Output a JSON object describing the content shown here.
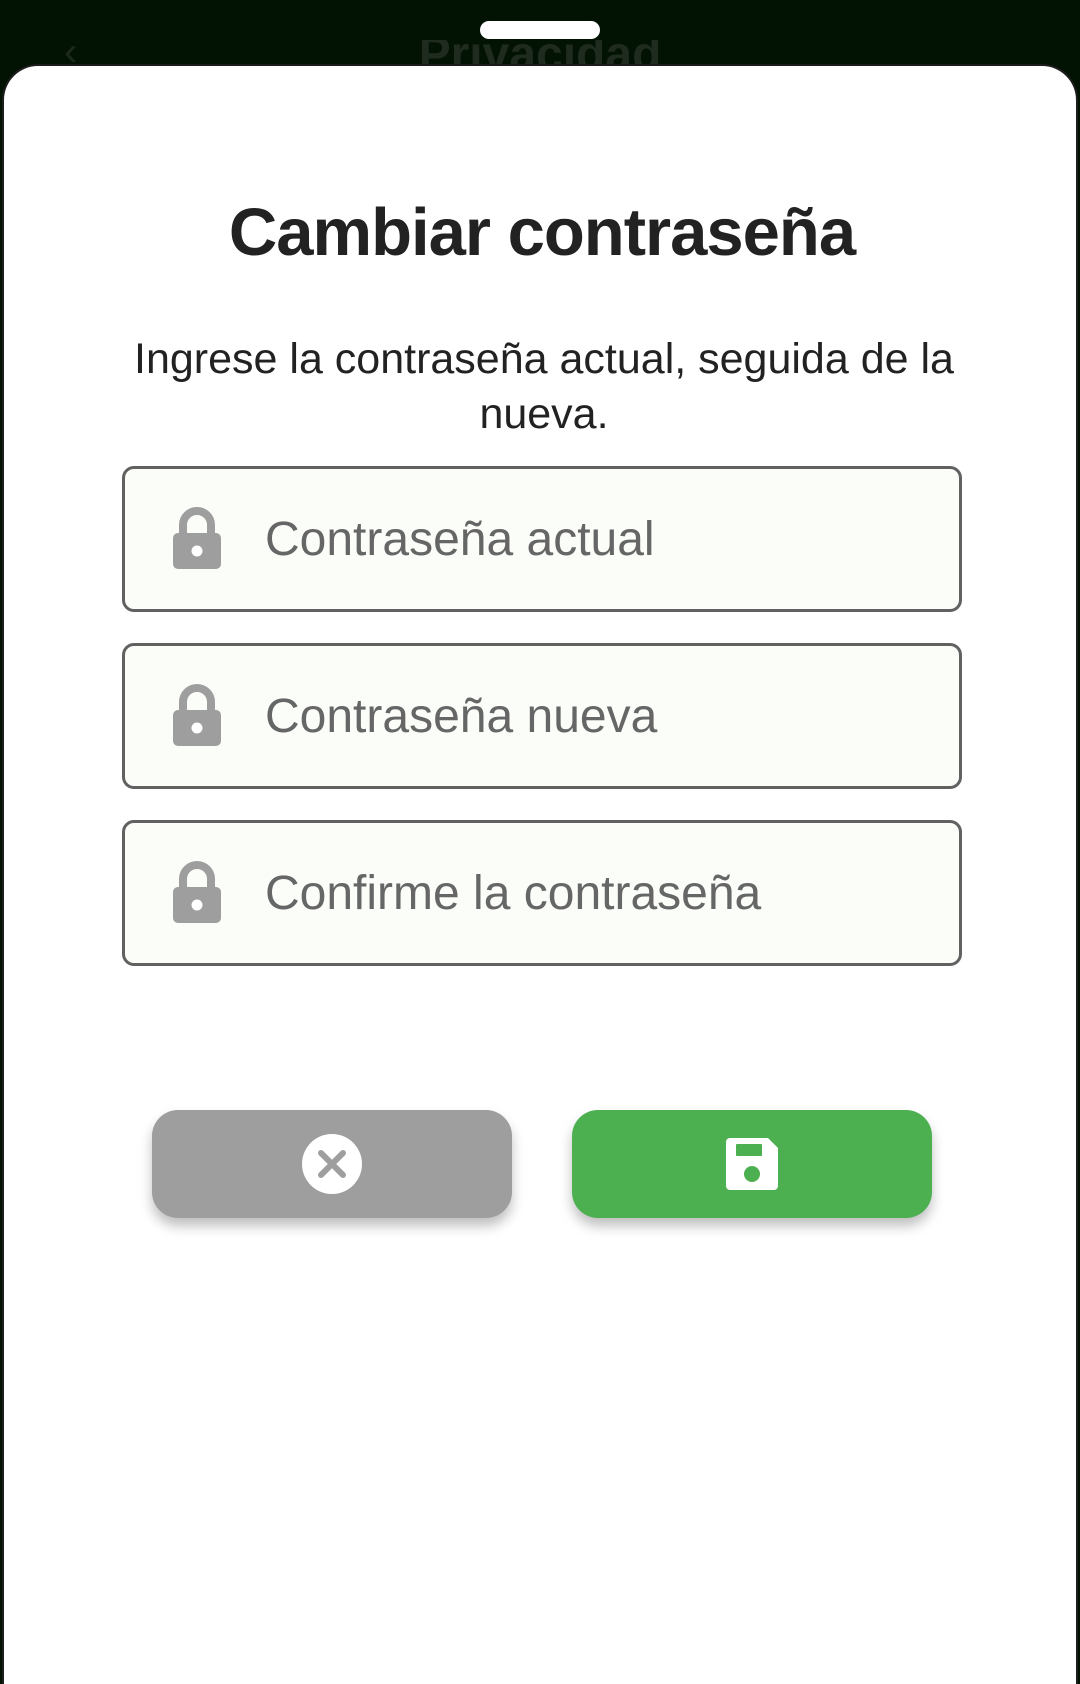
{
  "background_screen": {
    "title": "Privacidad",
    "back_icon": "back-arrow-icon"
  },
  "dialog": {
    "title": "Cambiar contraseña",
    "description": "Ingrese la contraseña actual, seguida de la nueva."
  },
  "fields": [
    {
      "placeholder": "Contraseña actual",
      "value": "",
      "icon": "lock-icon"
    },
    {
      "placeholder": "Contraseña nueva",
      "value": "",
      "icon": "lock-icon"
    },
    {
      "placeholder": "Confirme la contraseña",
      "value": "",
      "icon": "lock-icon"
    }
  ],
  "buttons": {
    "cancel": {
      "icon": "cancel-circle-icon",
      "color": "#9e9e9e"
    },
    "save": {
      "icon": "save-floppy-icon",
      "color": "#4caf50"
    }
  },
  "colors": {
    "accent": "#4caf50",
    "topbar": "#031303",
    "field_border": "#616161",
    "icon_gray": "#9e9e9e"
  }
}
